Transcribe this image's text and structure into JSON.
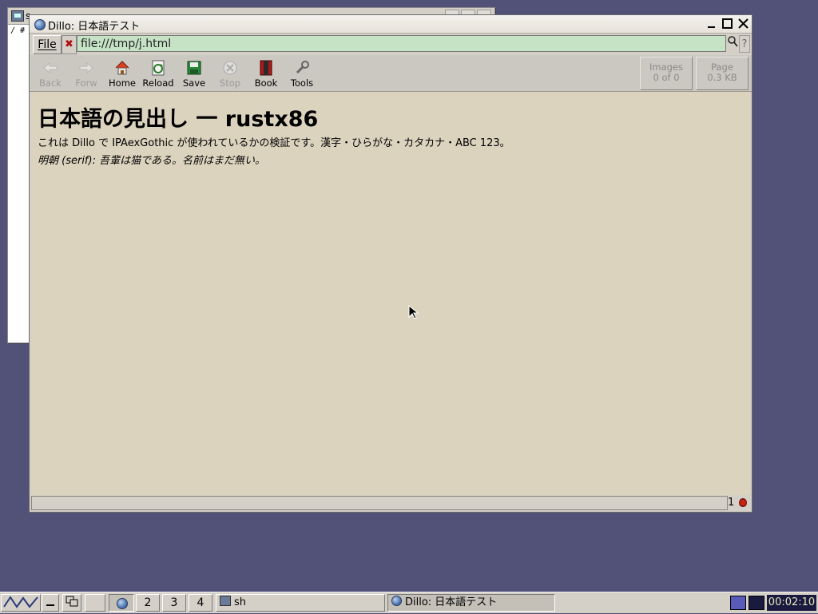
{
  "terminal": {
    "title": "s",
    "line": "/ #"
  },
  "window": {
    "title": "Dillo: 日本語テスト"
  },
  "menubar": {
    "file_label": "File",
    "clear_glyph": "✖",
    "url": "file:///tmp/j.html",
    "search_glyph": "⚲",
    "help_glyph": "?"
  },
  "toolbar": {
    "back": "Back",
    "forward": "Forw",
    "home": "Home",
    "reload": "Reload",
    "save": "Save",
    "stop": "Stop",
    "book": "Book",
    "tools": "Tools",
    "images_label": "Images",
    "images_value": "0 of 0",
    "page_label": "Page",
    "page_value": "0.3 KB"
  },
  "content": {
    "heading": "日本語の見出し 一 rustx86",
    "paragraph": "これは Dillo で IPAexGothic が使われているかの検証です。漢字・ひらがな・カタカナ・ABC 123。",
    "serif_label": "明朝 (serif):",
    "serif_text": "吾輩は猫である。名前はまだ無い。"
  },
  "status": {
    "count": "1"
  },
  "taskbar": {
    "workspaces": [
      "2",
      "3",
      "4"
    ],
    "tasks": [
      {
        "label": "sh"
      },
      {
        "label": "Dillo: 日本語テスト"
      }
    ],
    "clock": "00:02:10"
  }
}
